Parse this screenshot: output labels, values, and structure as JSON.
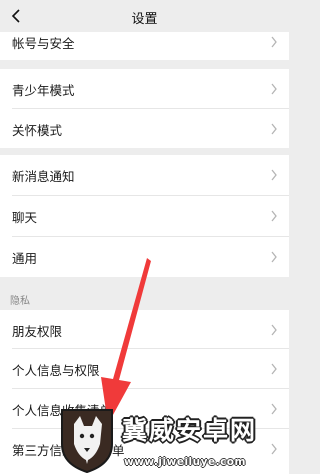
{
  "nav": {
    "title": "设置",
    "back_icon": "chevron-left-icon"
  },
  "groups": [
    {
      "items": [
        "帐号与安全"
      ]
    },
    {
      "items": [
        "青少年模式",
        "关怀模式"
      ]
    },
    {
      "items": [
        "新消息通知",
        "聊天",
        "通用"
      ]
    },
    {
      "header": "隐私",
      "items": [
        "朋友权限",
        "个人信息与权限",
        "个人信息收集清单",
        "第三方信息共享清单"
      ]
    }
  ],
  "annotation": {
    "color": "#f03a3a"
  },
  "watermark": {
    "title": "冀威安卓网",
    "url": "www.jiweiluye.com",
    "logo": "wolf-shield-logo"
  },
  "colors": {
    "background": "#ededed",
    "cell": "#ffffff",
    "annotation": "#f03a3a"
  }
}
